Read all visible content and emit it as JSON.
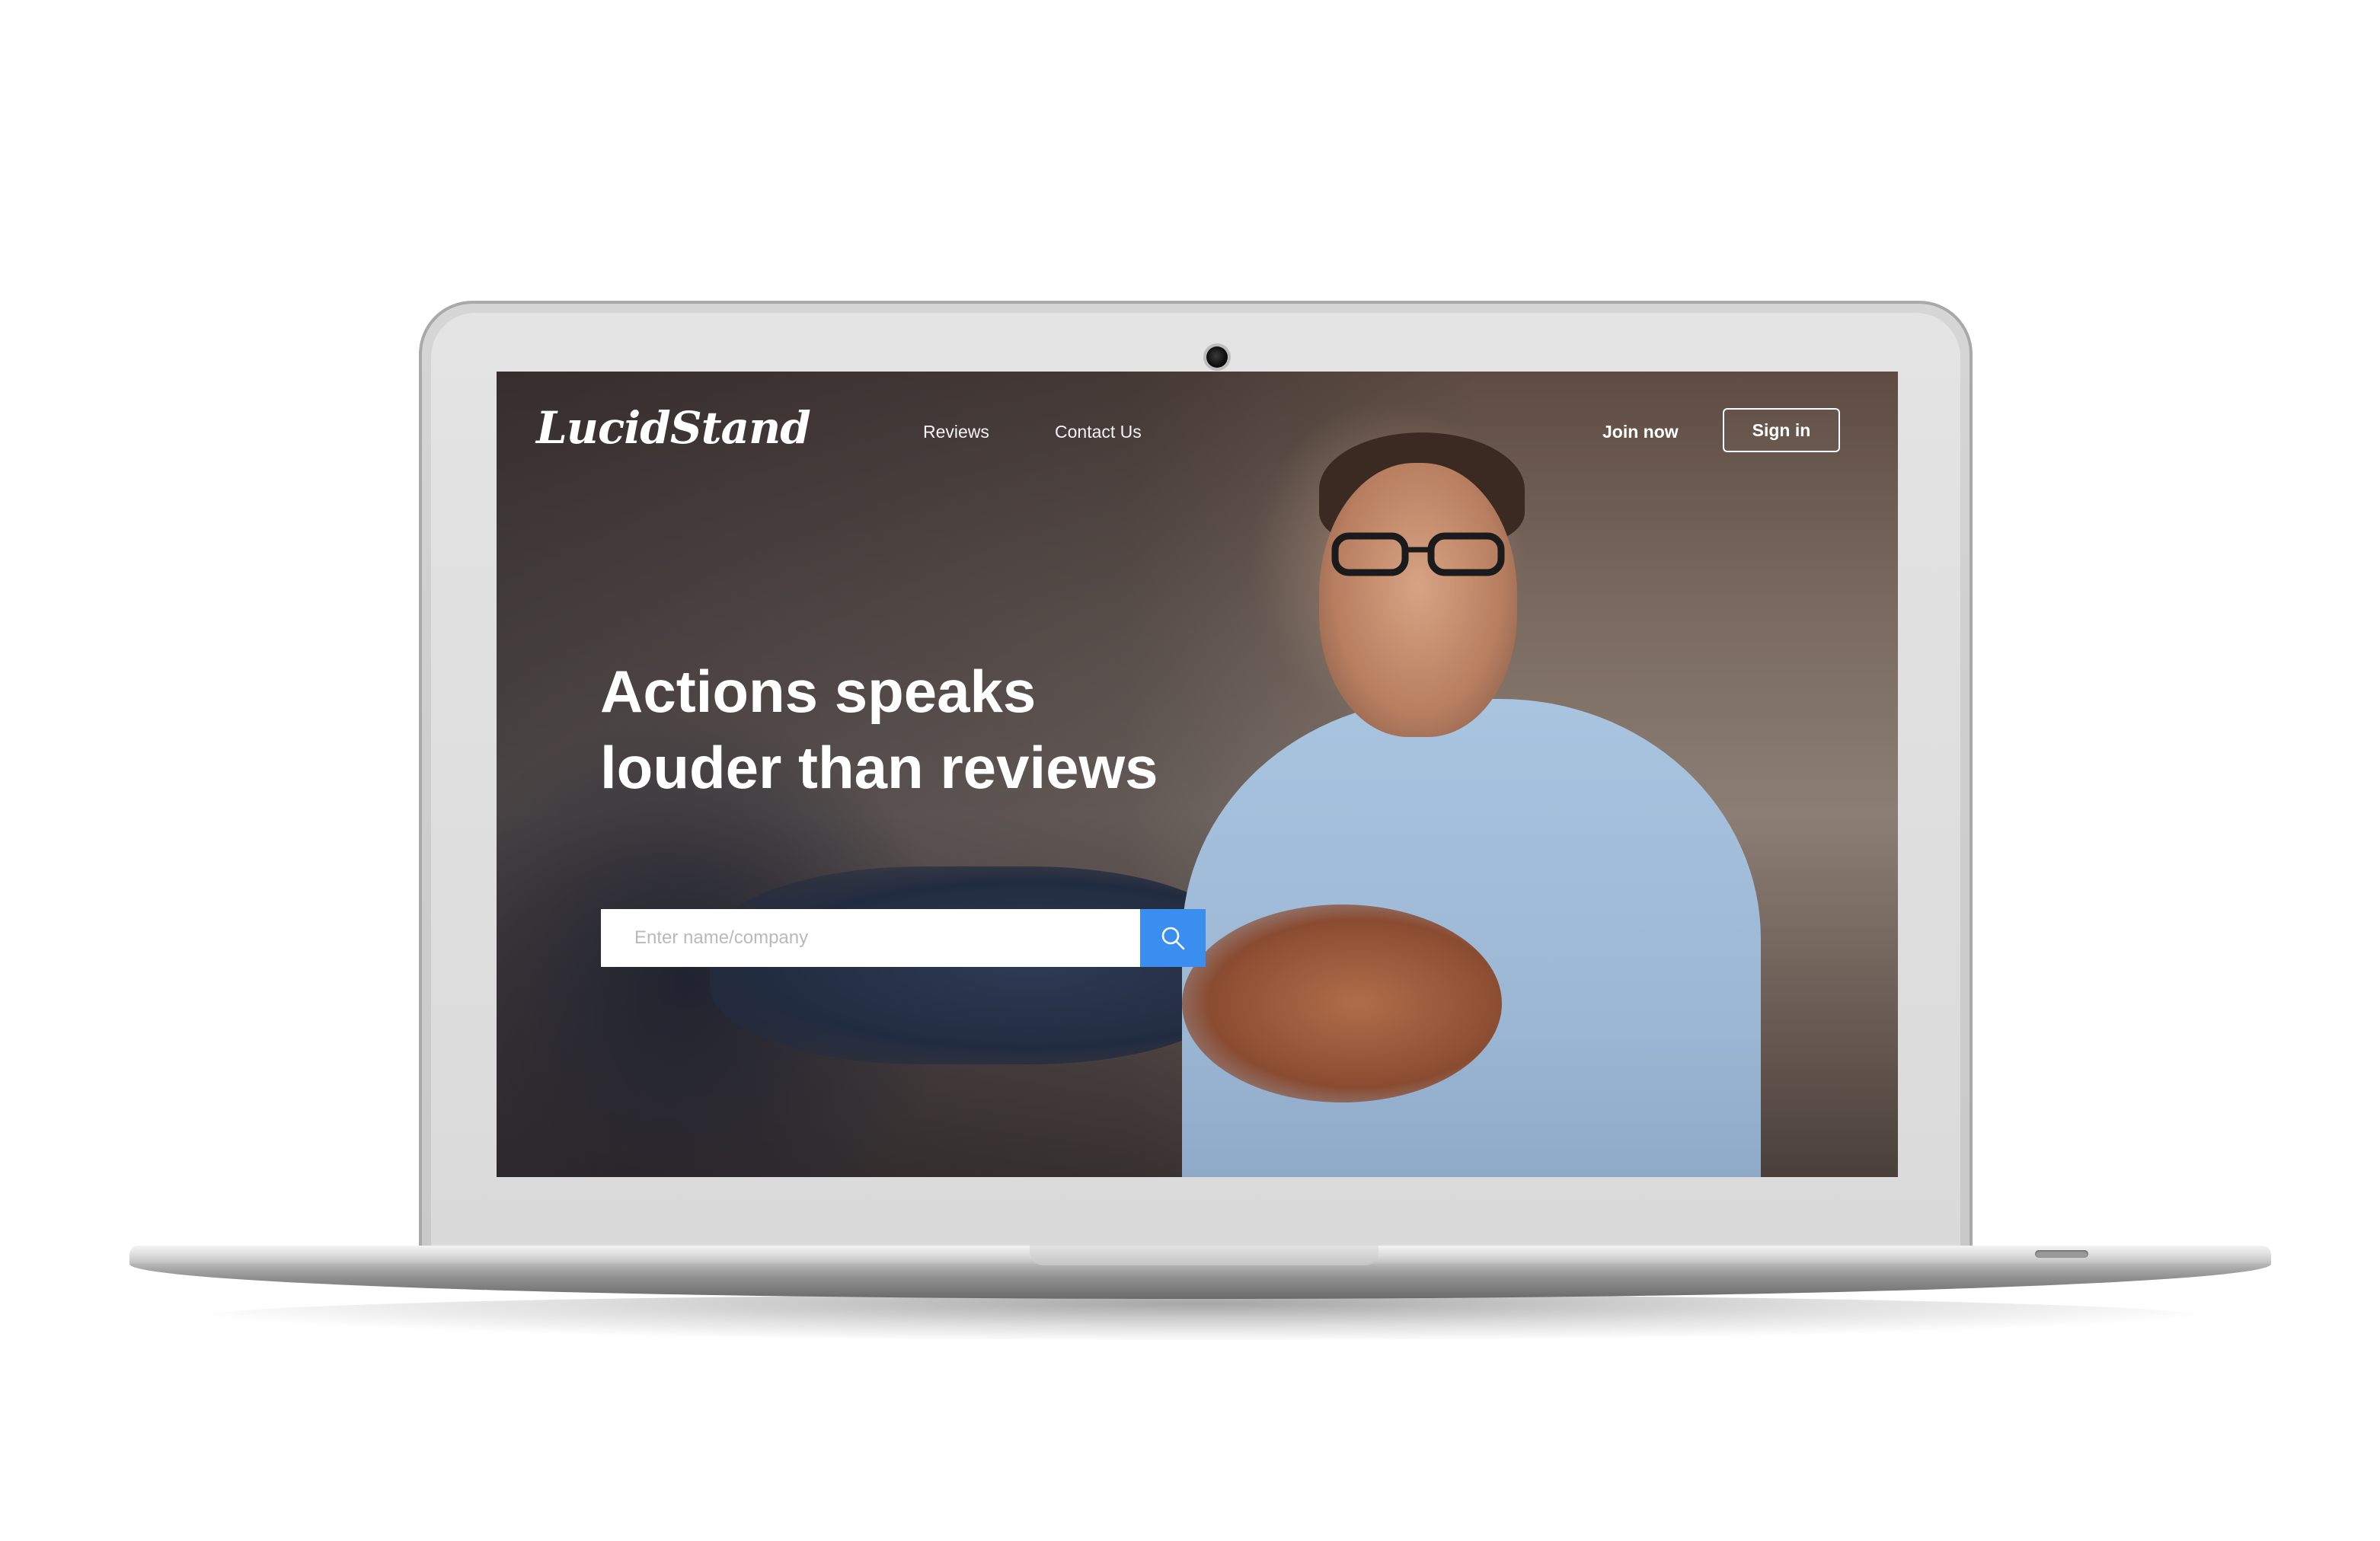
{
  "brand": {
    "logo_text": "LucidStand"
  },
  "nav": {
    "items": [
      {
        "label": "Reviews"
      },
      {
        "label": "Contact Us"
      }
    ],
    "join_label": "Join now",
    "signin_label": "Sign in"
  },
  "hero": {
    "title_line1": "Actions speaks",
    "title_line2": "louder than reviews"
  },
  "search": {
    "placeholder": "Enter name/company",
    "value": "",
    "button_icon": "search-icon"
  },
  "colors": {
    "accent": "#3a8ef0",
    "text_on_photo": "#ffffff"
  }
}
